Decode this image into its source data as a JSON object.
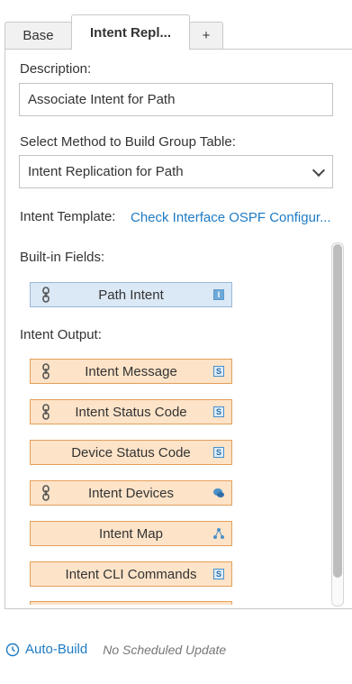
{
  "tabs": [
    {
      "label": "Base",
      "active": false
    },
    {
      "label": "Intent Repl...",
      "active": true
    },
    {
      "label": "+",
      "active": false
    }
  ],
  "description": {
    "label": "Description:",
    "value": "Associate Intent for Path"
  },
  "method": {
    "label": "Select Method to Build Group Table:",
    "value": "Intent Replication for Path"
  },
  "template": {
    "label": "Intent Template:",
    "link": "Check Interface OSPF Configur..."
  },
  "builtin": {
    "label": "Built-in Fields:",
    "fields": [
      {
        "label": "Path Intent",
        "left_icon": "link-icon",
        "right_icon": "type-i-icon",
        "right_text": "I"
      }
    ]
  },
  "output": {
    "label": "Intent Output:",
    "fields": [
      {
        "label": "Intent Message",
        "left_icon": "link-icon",
        "right_icon": "type-s-icon",
        "right_text": "S"
      },
      {
        "label": "Intent Status Code",
        "left_icon": "link-icon",
        "right_icon": "type-s-icon",
        "right_text": "S"
      },
      {
        "label": "Device Status Code",
        "left_icon": "",
        "right_icon": "type-s-icon",
        "right_text": "S"
      },
      {
        "label": "Intent Devices",
        "left_icon": "link-icon",
        "right_icon": "devices-icon",
        "right_text": ""
      },
      {
        "label": "Intent Map",
        "left_icon": "",
        "right_icon": "map-icon",
        "right_text": ""
      },
      {
        "label": "Intent CLI Commands",
        "left_icon": "",
        "right_icon": "type-s-icon",
        "right_text": "S"
      }
    ]
  },
  "footer": {
    "auto_build": "Auto-Build",
    "schedule": "No Scheduled Update"
  },
  "colors": {
    "accent": "#1e7bc4",
    "orange_field": "#fde3c8",
    "blue_field": "#dbe8f6"
  }
}
